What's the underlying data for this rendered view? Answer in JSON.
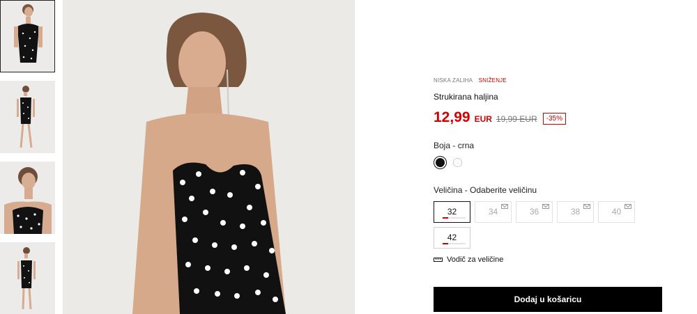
{
  "product": {
    "tags": {
      "stock": "NISKA ZALIHA",
      "sale": "SNIŽENJE"
    },
    "title": "Strukirana haljina",
    "price": {
      "current": "12,99",
      "currency": "EUR",
      "old": "19,99 EUR",
      "discount": "-35%"
    },
    "color": {
      "label": "Boja",
      "separator": " - ",
      "selected": "crna",
      "accent": "#d40000"
    },
    "size": {
      "label": "Veličina",
      "separator": " - ",
      "prompt": "Odaberite veličinu",
      "options": [
        {
          "value": "32",
          "available": true,
          "selected": true,
          "stock_level": 0.25
        },
        {
          "value": "34",
          "available": false
        },
        {
          "value": "36",
          "available": false
        },
        {
          "value": "38",
          "available": false
        },
        {
          "value": "40",
          "available": false
        },
        {
          "value": "42",
          "available": true,
          "selected": false,
          "stock_level": 0.25
        }
      ]
    },
    "size_guide": "Vodič za veličine",
    "add_to_cart": "Dodaj u košaricu"
  },
  "icons": {
    "swatch_black": "polka-dot-black-swatch-icon",
    "swatch_white": "polka-dot-white-swatch-icon",
    "notify": "mail-icon",
    "ruler": "ruler-icon"
  }
}
